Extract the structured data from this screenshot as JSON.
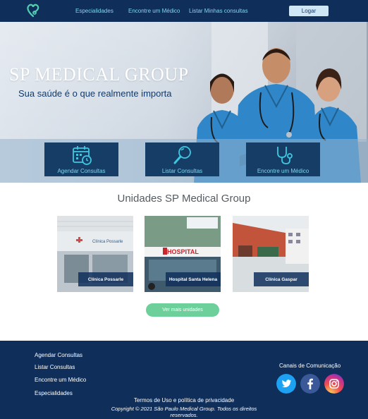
{
  "nav": {
    "links": [
      "Especialidades",
      "Encontre um Médico",
      "Listar Minhas consultas"
    ],
    "login": "Logar"
  },
  "hero": {
    "title": "SP MEDICAL GROUP",
    "subtitle": "Sua saúde é o que realmente importa",
    "actions": [
      "Agendar Consultas",
      "Listar Consultas",
      "Encontre um Médico"
    ]
  },
  "units": {
    "title": "Unidades SP Medical Group",
    "cards": [
      "Clínica Possarle",
      "Hospital Santa Helena",
      "Clínica Gaspar"
    ],
    "sign_possarle": "Clínica Possarle",
    "sign_hospital": "HOSPITAL",
    "more": "Ver mais unidades"
  },
  "footer": {
    "links": [
      "Agendar Consultas",
      "Listar Consultas",
      "Encontre um Médico",
      "Especialidades"
    ],
    "channels": "Canais de Comunicação",
    "terms": "Termos de Uso e política de privacidade",
    "copyright": "Copyright © 2021 São Paulo Medical Group. Todos os direitos reservados."
  },
  "colors": {
    "navy": "#0f2f5a",
    "accent_cyan": "#7fd6f0",
    "green_button": "#6dcf9a",
    "scrub_blue": "#2f86c9"
  },
  "icons": [
    "heart-stethoscope-logo-icon",
    "calendar-clock-icon",
    "magnifier-icon",
    "stethoscope-icon",
    "twitter-icon",
    "facebook-icon",
    "instagram-icon"
  ]
}
